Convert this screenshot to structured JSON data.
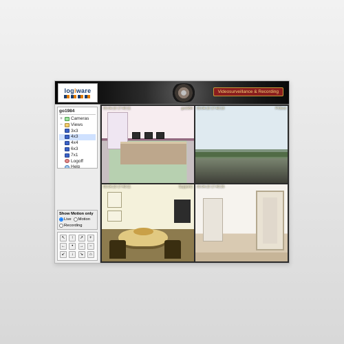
{
  "brand": {
    "name": "logiware",
    "accent_word": "i"
  },
  "header": {
    "banner": "Videosurveillance & Recording"
  },
  "tree": {
    "title": "go1984",
    "items": [
      {
        "label": "Cameras",
        "type": "cam",
        "twist": "+"
      },
      {
        "label": "Views",
        "type": "folder",
        "twist": "−",
        "children": [
          {
            "label": "3x3",
            "type": "view"
          },
          {
            "label": "4x3",
            "type": "view",
            "selected": true
          },
          {
            "label": "4x4",
            "type": "view"
          },
          {
            "label": "6x3",
            "type": "view"
          },
          {
            "label": "7x1",
            "type": "view"
          }
        ]
      },
      {
        "label": "Logoff",
        "type": "logoff"
      },
      {
        "label": "Help",
        "type": "help"
      }
    ]
  },
  "motion": {
    "title": "Show Motion only",
    "options": [
      "Live",
      "Motion",
      "Recording"
    ]
  },
  "ptz": [
    "↖",
    "↑",
    "↗",
    "+",
    "←",
    "•",
    "→",
    "−",
    "↙",
    "↓",
    "↘",
    "⌂"
  ],
  "cameras": [
    {
      "ts": "09.04.10 17:40:11",
      "name": "go1984"
    },
    {
      "ts": "09.04.10 17:40:13",
      "name": "Pr0test"
    },
    {
      "ts": "09.04.10 17:40:11",
      "name": "Support1"
    },
    {
      "ts": "09.04.10 17:40:26",
      "name": ""
    }
  ]
}
